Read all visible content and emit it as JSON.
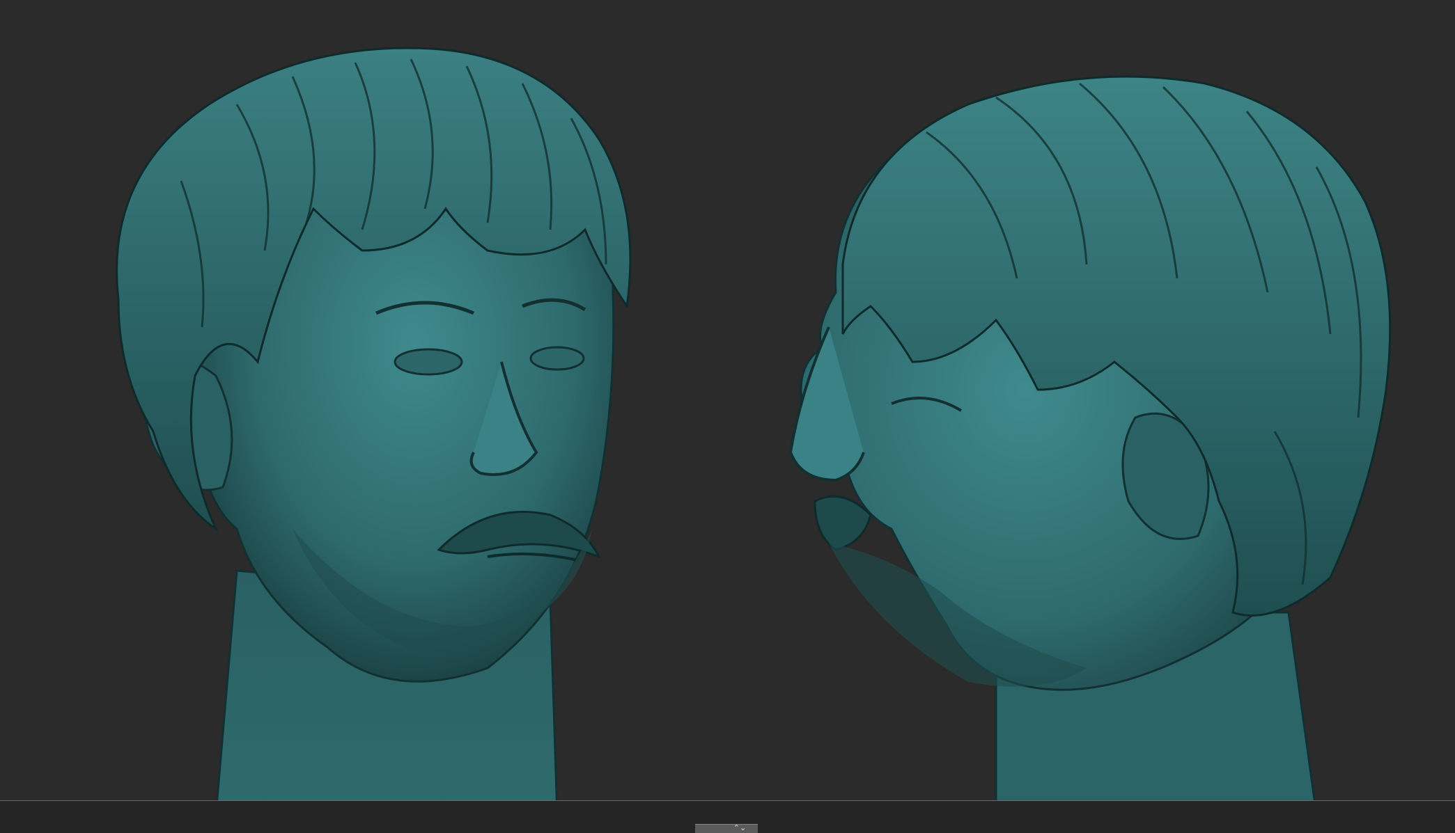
{
  "viewport": {
    "background": "#2b2b2b",
    "model_color": "#2f6f72",
    "model_highlight": "#4aa3a6",
    "model_shadow": "#153335"
  },
  "views": [
    {
      "name": "front-three-quarter-view"
    },
    {
      "name": "side-profile-view"
    }
  ],
  "timeline": {
    "handle_icon": "double-chevron-icon",
    "handle_glyph": "⌃⌄"
  }
}
